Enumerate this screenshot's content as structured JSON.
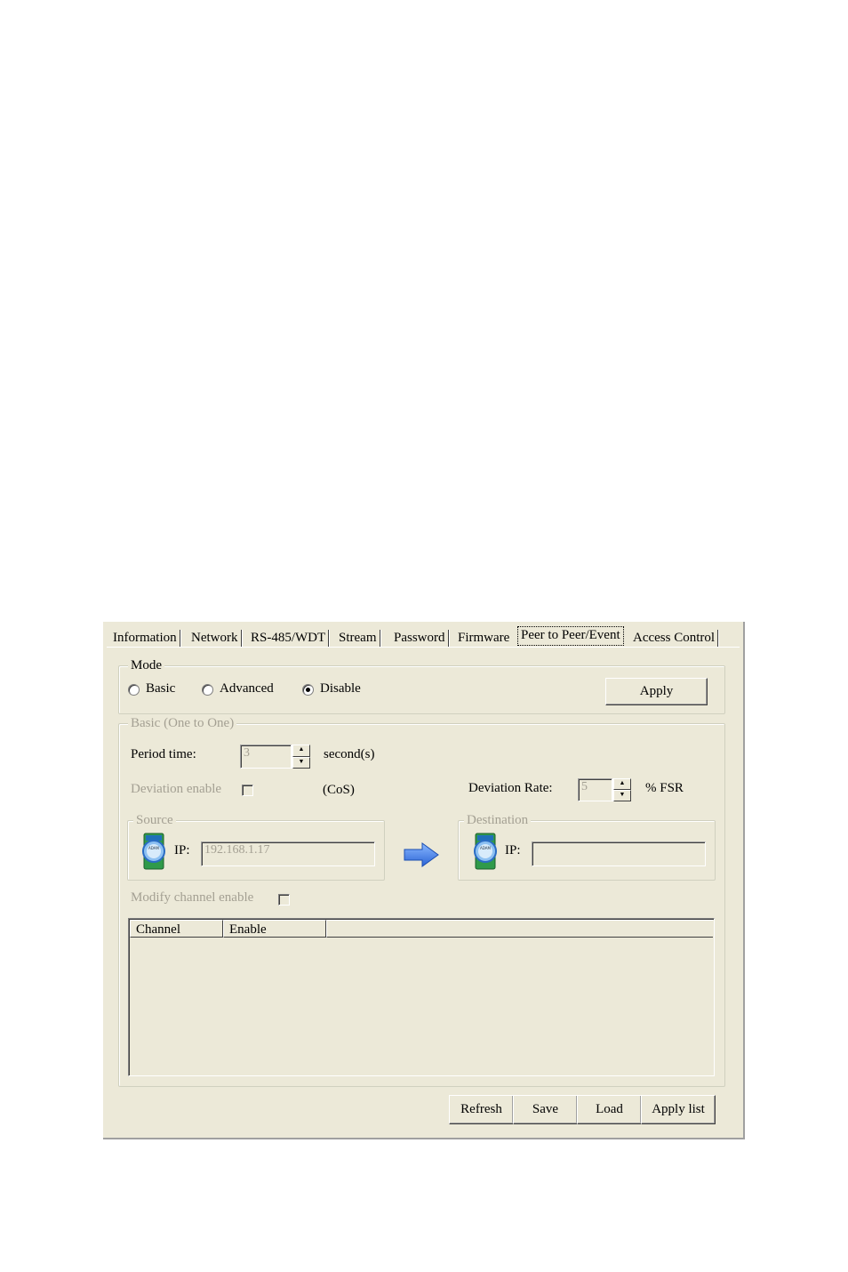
{
  "tabs": [
    {
      "label": "Information",
      "active": false
    },
    {
      "label": "Network",
      "active": false
    },
    {
      "label": "RS-485/WDT",
      "active": false
    },
    {
      "label": "Stream",
      "active": false
    },
    {
      "label": "Password",
      "active": false
    },
    {
      "label": "Firmware",
      "active": false
    },
    {
      "label": "Peer to Peer/Event",
      "active": true
    },
    {
      "label": "Access Control",
      "active": false
    }
  ],
  "mode": {
    "legend": "Mode",
    "options": [
      {
        "label": "Basic",
        "selected": false
      },
      {
        "label": "Advanced",
        "selected": false
      },
      {
        "label": "Disable",
        "selected": true
      }
    ],
    "apply_label": "Apply"
  },
  "basic": {
    "legend": "Basic (One to One)",
    "period_label": "Period time:",
    "period_value": "3",
    "period_unit": "second(s)",
    "deviation_enable_label": "Deviation enable",
    "deviation_enable_checked": false,
    "cos_label": "(CoS)",
    "deviation_rate_label": "Deviation Rate:",
    "deviation_rate_value": "5",
    "deviation_rate_unit": "% FSR",
    "source": {
      "legend": "Source",
      "ip_label": "IP:",
      "ip_value": "192.168.1.17",
      "icon_text": "ADAM"
    },
    "destination": {
      "legend": "Destination",
      "ip_label": "IP:",
      "ip_value": "",
      "icon_text": "ADAM"
    },
    "modify_channel_label": "Modify channel enable",
    "modify_channel_checked": false,
    "table_columns": [
      "Channel",
      "Enable"
    ],
    "table_rows": []
  },
  "footer_buttons": {
    "refresh": "Refresh",
    "save": "Save",
    "load": "Load",
    "apply_list": "Apply list"
  },
  "colors": {
    "panel": "#ece9d8",
    "disabled_text": "#a4a093",
    "arrow": "#3a7ee8"
  }
}
